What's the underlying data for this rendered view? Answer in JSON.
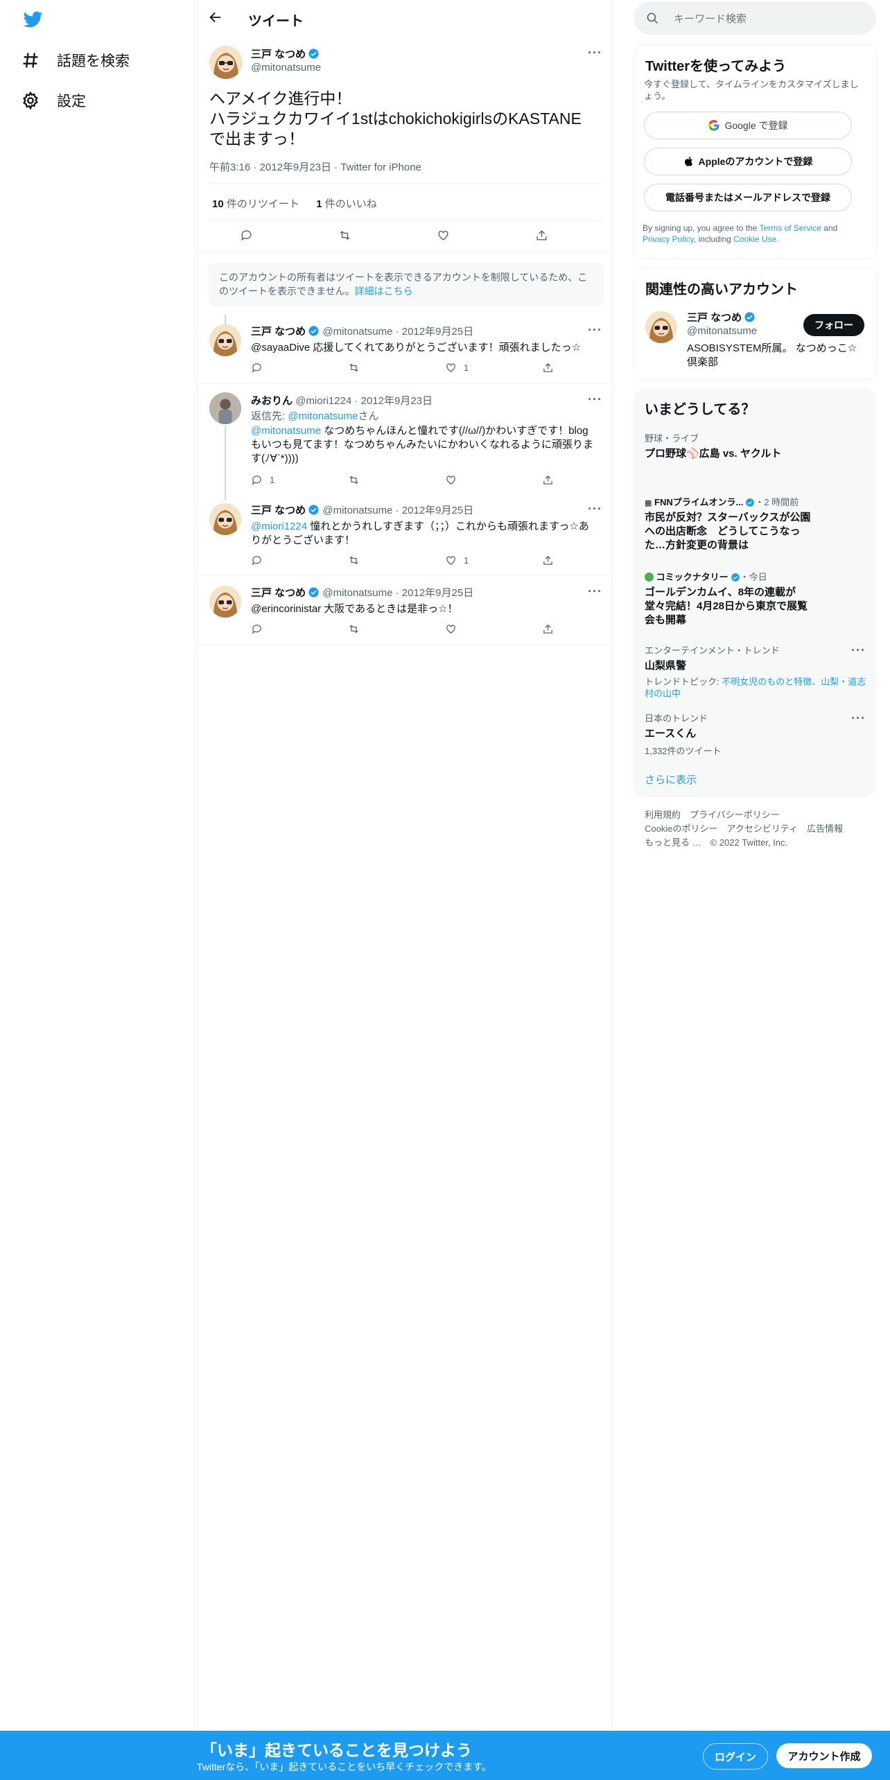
{
  "nav": {
    "explore_label": "話題を検索",
    "settings_label": "設定"
  },
  "header": {
    "title": "ツイート"
  },
  "tweet": {
    "author_name": "三戸 なつめ",
    "author_handle": "@mitonatsume",
    "text_line1": "ヘアメイク進行中！",
    "text_line2": "ハラジュクカワイイ1stはchokichokigirlsのKASTANE",
    "text_line3": "で出ますっ！",
    "time": "午前3:16",
    "date": "2012年9月23日",
    "source": "Twitter for iPhone",
    "retweet_count": "10",
    "retweet_label": "件のリツイート",
    "like_count": "1",
    "like_label": "件のいいね"
  },
  "restricted_notice": {
    "text": "このアカウントの所有者はツイートを表示できるアカウントを制限しているため、このツイートを表示できません。",
    "link": "詳細はこちら"
  },
  "replies": [
    {
      "name": "三戸 なつめ",
      "handle": "@mitonatsume",
      "date": "2012年9月25日",
      "body": "@sayaaDive 応援してくれてありがとうございます！頑張れましたっ☆",
      "reply_count": "",
      "like_count": "1"
    },
    {
      "name": "みおりん",
      "handle": "@miori1224",
      "date": "2012年9月23日",
      "replying_to_label": "返信先:",
      "replying_to": "@mitonatsume",
      "replying_to_suffix": "さん",
      "mention": "@mitonatsume",
      "body": "なつめちゃんほんと憧れです(//ω//)かわいすぎです！blogもいつも見てます！なつめちゃんみたいにかわいくなれるように頑張ります(ﾉ∀`*))))",
      "reply_count": "1",
      "like_count": ""
    },
    {
      "name": "三戸 なつめ",
      "handle": "@mitonatsume",
      "date": "2012年9月25日",
      "mention": "@miori1224",
      "body": "憧れとかうれしすぎます（；；）これからも頑張れますっ☆ありがとうございます！",
      "reply_count": "",
      "like_count": "1"
    },
    {
      "name": "三戸 なつめ",
      "handle": "@mitonatsume",
      "date": "2012年9月25日",
      "body": "@erincorinistar 大阪であるときは是非っ☆！",
      "reply_count": "",
      "like_count": ""
    }
  ],
  "search": {
    "placeholder": "キーワード検索"
  },
  "signup": {
    "title": "Twitterを使ってみよう",
    "subtitle": "今すぐ登録して、タイムラインをカスタマイズしましょう。",
    "google_btn": "Google で登録",
    "apple_btn": "Appleのアカウントで登録",
    "email_btn": "電話番号またはメールアドレスで登録",
    "terms_prefix": "By signing up, you agree to the",
    "terms_link": "Terms of Service",
    "terms_and": "and",
    "privacy_link": "Privacy Policy",
    "terms_including": ", including",
    "cookie_link": "Cookie Use."
  },
  "related": {
    "title": "関連性の高いアカウント",
    "name": "三戸 なつめ",
    "handle": "@mitonatsume",
    "follow_btn": "フォロー",
    "bio": "ASOBISYSTEM所属。 なつめっこ☆倶楽部"
  },
  "trends": {
    "title": "いまどうしてる？",
    "items": [
      {
        "category": "野球・ライブ",
        "title": "プロ野球⚾広島 vs. ヤクルト"
      },
      {
        "category": "FNNプライムオンラ...",
        "meta": "・2 時間前",
        "title": "市民が反対？スターバックスが公園への出店断念　どうしてこうなった…方針変更の背景は"
      },
      {
        "category": "コミックナタリー",
        "meta": "・今日",
        "title": "ゴールデンカムイ、8年の連載が堂々完結！4月28日から東京で展覧会も開幕"
      },
      {
        "category": "エンターテインメント・トレンド",
        "title": "山梨県警",
        "topic_label": "トレンドトピック:",
        "topic": "不明女児のものと特徴、山梨・道志村の山中"
      },
      {
        "category": "日本のトレンド",
        "title": "エースくん",
        "count": "1,332件のツイート"
      }
    ],
    "more": "さらに表示"
  },
  "footer": {
    "terms": "利用規約",
    "privacy": "プライバシーポリシー",
    "cookie": "Cookieのポリシー",
    "accessibility": "アクセシビリティ",
    "ads": "広告情報",
    "more": "もっと見る …",
    "copyright": "© 2022 Twitter, Inc."
  },
  "bottombar": {
    "title": "「いま」起きていることを見つけよう",
    "subtitle": "Twitterなら、「いま」起きていることをいち早くチェックできます。",
    "login": "ログイン",
    "signup": "アカウント作成"
  },
  "colors": {
    "accent": "#1d9bf0",
    "text": "#0f1419",
    "muted": "#536471"
  }
}
